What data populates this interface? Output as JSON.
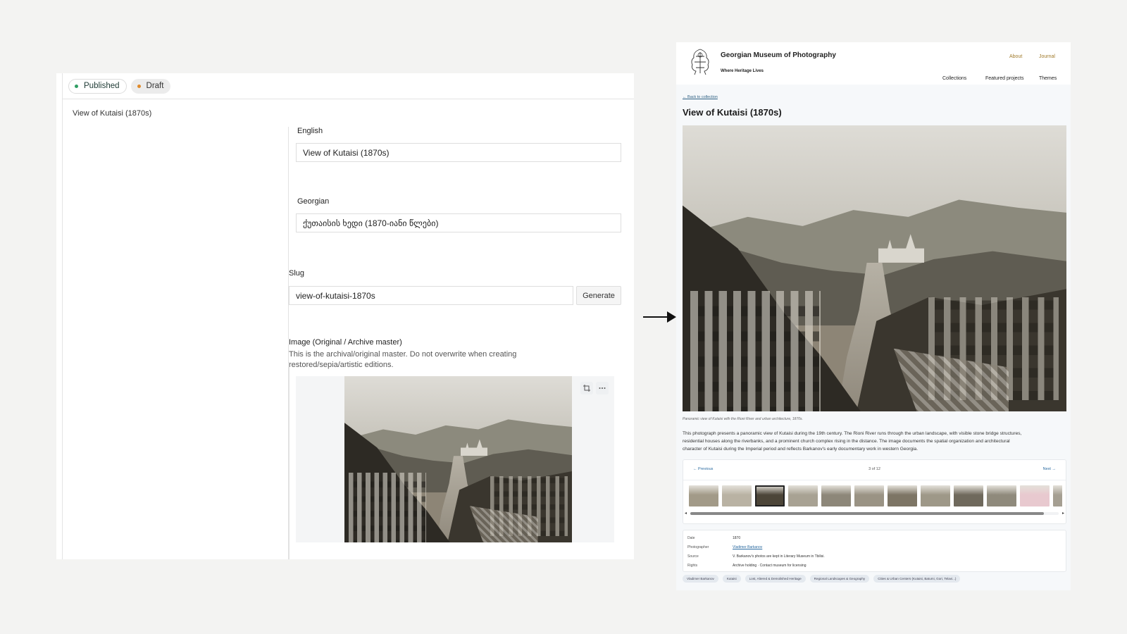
{
  "cms": {
    "status": [
      {
        "label": "Published",
        "color": "#2f9e63"
      },
      {
        "label": "Draft",
        "color": "#e08a2a"
      }
    ],
    "doc_title": "View of Kutaisi (1870s)",
    "title_field": {
      "english_label": "English",
      "english_value": "View of Kutaisi (1870s)",
      "georgian_label": "Georgian",
      "georgian_value": "ქუთაისის ხედი (1870-იანი წლები)"
    },
    "slug": {
      "label": "Slug",
      "value": "view-of-kutaisi-1870s",
      "generate_label": "Generate"
    },
    "image": {
      "label": "Image (Original / Archive master)",
      "description_line1": "This is the archival/original master. Do not overwrite when creating",
      "description_line2": "restored/sepia/artistic editions.",
      "tool_crop": "crop-icon",
      "tool_more": "more-icon"
    }
  },
  "site": {
    "brand": "Georgian Museum of Photography",
    "tagline": "Where Heritage Lives",
    "top_links": [
      "About",
      "Journal"
    ],
    "nav": [
      "Collections",
      "Featured projects",
      "Themes"
    ],
    "back_link": "← Back to collection",
    "title": "View of Kutaisi (1870s)",
    "caption": "Panoramic view of Kutaisi with the Rioni River and urban architecture, 1870s.",
    "description_lines": [
      "This photograph presents a panoramic view of Kutaisi during the 19th century. The Rioni River runs through the urban landscape, with visible stone bridge structures,",
      "residential houses along the riverbanks, and a prominent church complex rising in the distance. The image documents the spatial organization and architectural",
      "character of Kutaisi during the Imperial period and reflects Barkanov's early documentary work in western Georgia."
    ],
    "gallery": {
      "prev": "← Previous",
      "counter": "3 of 12",
      "next": "Next →",
      "active_index": 2,
      "thumb_tones": [
        "#a29a88",
        "#b9b2a3",
        "#4c4538",
        "#a8a293",
        "#8d8779",
        "#9a9384",
        "#7d7565",
        "#9e9888",
        "#6f695c",
        "#8f8a7c",
        "#e8c9cf",
        "#a59f92"
      ]
    },
    "meta": [
      {
        "key": "Date",
        "value": "1870",
        "link": false
      },
      {
        "key": "Photographer",
        "value": "Vladimer Barkanov",
        "link": true
      },
      {
        "key": "Source",
        "value": "V. Barkanov's photos are kept in Literary Museum in Tbilisi.",
        "link": false
      },
      {
        "key": "Rights",
        "value": "Archive holding · Contact museum for licensing",
        "link": false
      }
    ],
    "tags": [
      "Vladimer Barkanov",
      "Kutaisi",
      "Lost, Altered & Demolished Heritage",
      "Regional Landscapes & Geography",
      "Cities & Urban Centers (Kutaisi, Batumi, Gori, Telavi...)"
    ]
  }
}
